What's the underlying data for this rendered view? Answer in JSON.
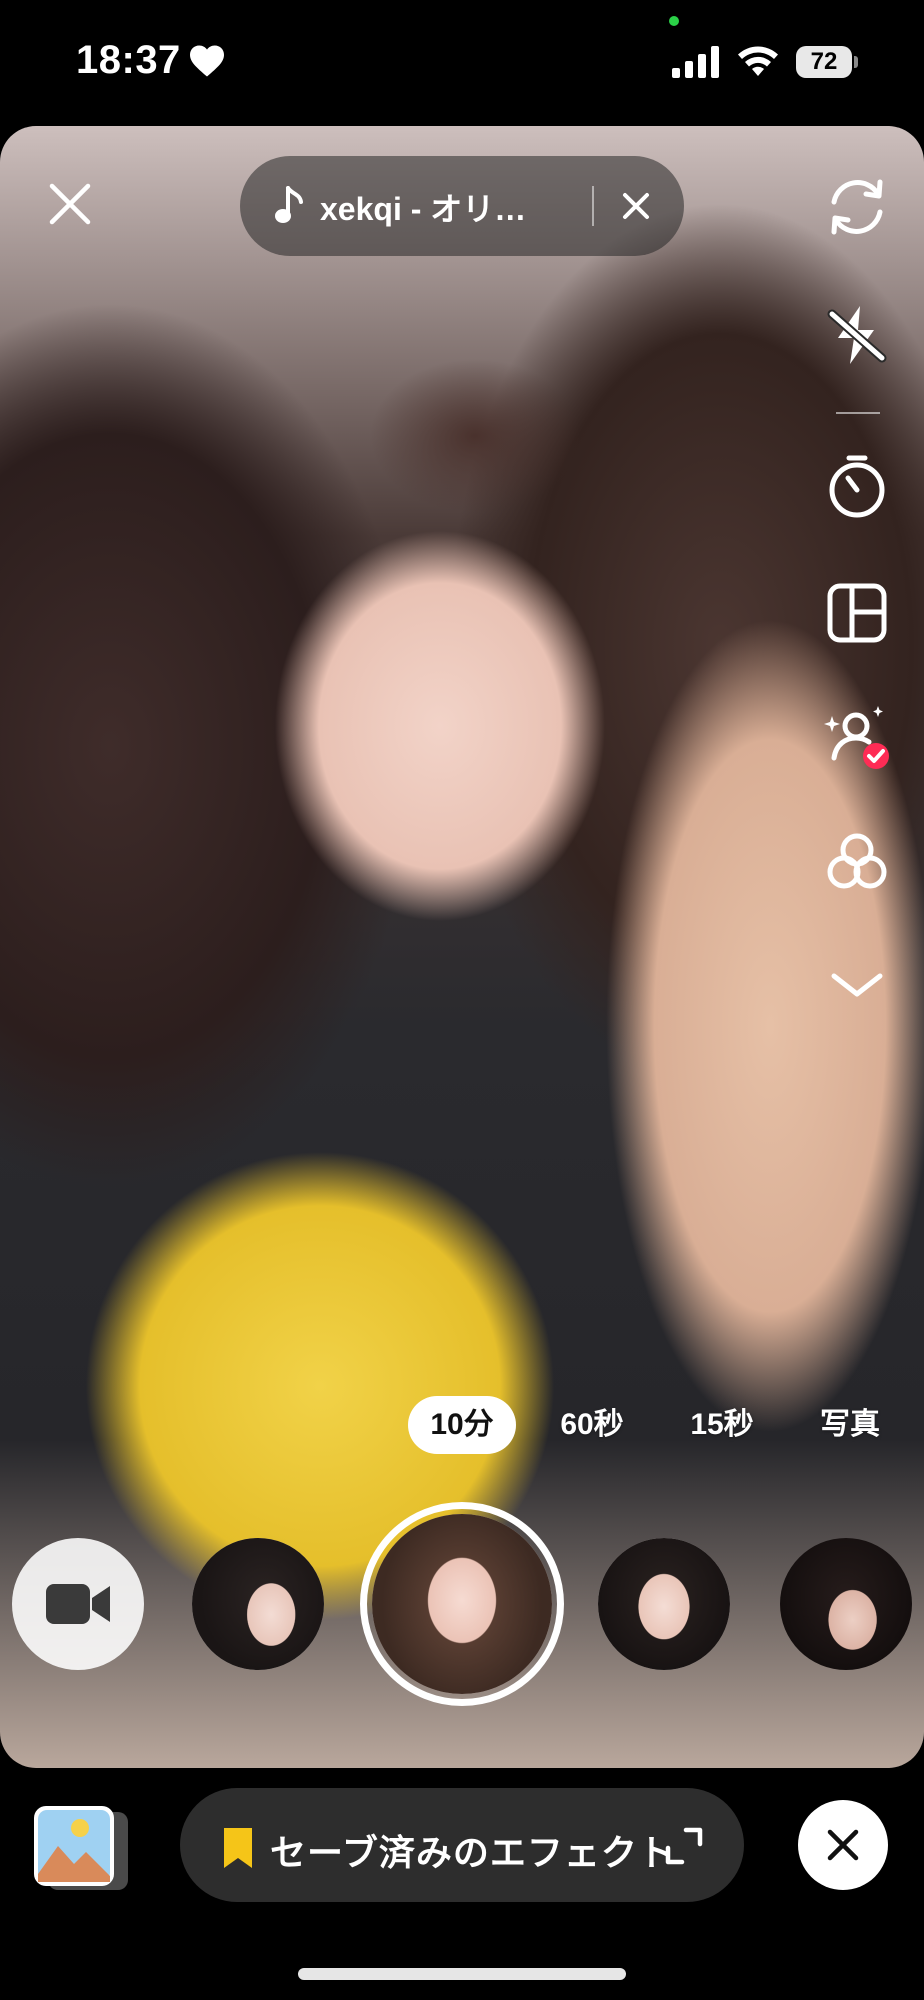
{
  "status_bar": {
    "time": "18:37",
    "battery": "72"
  },
  "sound": {
    "title": "xekqi - オリ…"
  },
  "tool_rail": {
    "items": [
      "flip-camera-icon",
      "flash-off-icon",
      "timer-icon",
      "layout-icon",
      "retouch-icon",
      "filters-icon",
      "more-chevron-icon"
    ]
  },
  "durations": {
    "tabs": [
      "10分",
      "60秒",
      "15秒",
      "写真"
    ],
    "selected": "10分"
  },
  "effects": {
    "selected_index": 1,
    "count": 4
  },
  "bottom_bar": {
    "saved_effects_label": "セーブ済みのエフェクト"
  },
  "colors": {
    "accent_yellow": "#f5c518",
    "badge_red": "#fe2c55",
    "pill_bg": "#2d2d2d"
  }
}
